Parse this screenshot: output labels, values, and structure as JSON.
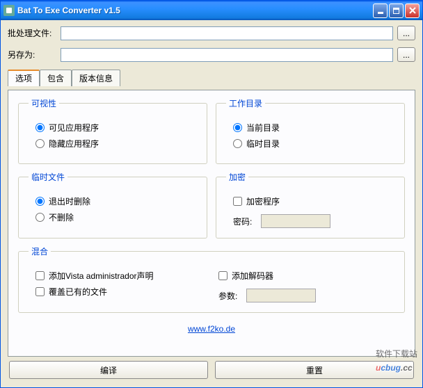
{
  "window": {
    "title": "Bat To Exe Converter v1.5"
  },
  "files": {
    "batch_label": "批处理文件:",
    "batch_value": "",
    "saveas_label": "另存为:",
    "saveas_value": "",
    "browse_label": "..."
  },
  "tabs": {
    "options": "选项",
    "include": "包含",
    "version": "版本信息"
  },
  "visibility": {
    "legend": "可视性",
    "visible": "可见应用程序",
    "hidden": "隐藏应用程序"
  },
  "workdir": {
    "legend": "工作目录",
    "current": "当前目录",
    "temp": "临时目录"
  },
  "tempfiles": {
    "legend": "临时文件",
    "delete_on_exit": "退出时删除",
    "dont_delete": "不删除"
  },
  "encrypt": {
    "legend": "加密",
    "encrypt_program": "加密程序",
    "password_label": "密码:",
    "password_value": ""
  },
  "mixed": {
    "legend": "混合",
    "vista_admin": "添加Vista administrador声明",
    "overwrite_existing": "覆盖已有的文件",
    "add_decoder": "添加解码器",
    "param_label": "参数:",
    "param_value": ""
  },
  "link": "www.f2ko.de",
  "buttons": {
    "compile": "编译",
    "reset": "重置"
  },
  "watermark": {
    "text_top": "软件下载站",
    "brand": "ucbug.cc"
  }
}
